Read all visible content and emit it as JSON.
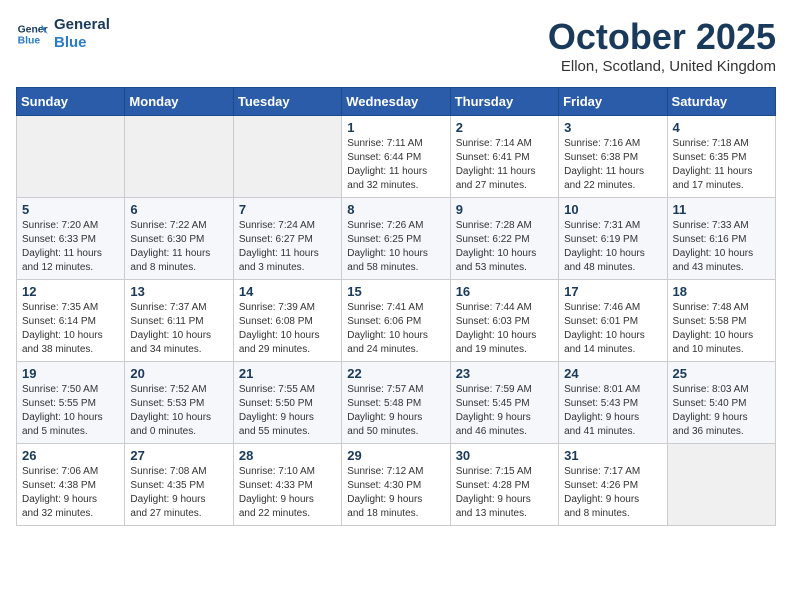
{
  "header": {
    "logo_line1": "General",
    "logo_line2": "Blue",
    "month_title": "October 2025",
    "location": "Ellon, Scotland, United Kingdom"
  },
  "weekdays": [
    "Sunday",
    "Monday",
    "Tuesday",
    "Wednesday",
    "Thursday",
    "Friday",
    "Saturday"
  ],
  "weeks": [
    [
      {
        "day": "",
        "info": ""
      },
      {
        "day": "",
        "info": ""
      },
      {
        "day": "",
        "info": ""
      },
      {
        "day": "1",
        "info": "Sunrise: 7:11 AM\nSunset: 6:44 PM\nDaylight: 11 hours\nand 32 minutes."
      },
      {
        "day": "2",
        "info": "Sunrise: 7:14 AM\nSunset: 6:41 PM\nDaylight: 11 hours\nand 27 minutes."
      },
      {
        "day": "3",
        "info": "Sunrise: 7:16 AM\nSunset: 6:38 PM\nDaylight: 11 hours\nand 22 minutes."
      },
      {
        "day": "4",
        "info": "Sunrise: 7:18 AM\nSunset: 6:35 PM\nDaylight: 11 hours\nand 17 minutes."
      }
    ],
    [
      {
        "day": "5",
        "info": "Sunrise: 7:20 AM\nSunset: 6:33 PM\nDaylight: 11 hours\nand 12 minutes."
      },
      {
        "day": "6",
        "info": "Sunrise: 7:22 AM\nSunset: 6:30 PM\nDaylight: 11 hours\nand 8 minutes."
      },
      {
        "day": "7",
        "info": "Sunrise: 7:24 AM\nSunset: 6:27 PM\nDaylight: 11 hours\nand 3 minutes."
      },
      {
        "day": "8",
        "info": "Sunrise: 7:26 AM\nSunset: 6:25 PM\nDaylight: 10 hours\nand 58 minutes."
      },
      {
        "day": "9",
        "info": "Sunrise: 7:28 AM\nSunset: 6:22 PM\nDaylight: 10 hours\nand 53 minutes."
      },
      {
        "day": "10",
        "info": "Sunrise: 7:31 AM\nSunset: 6:19 PM\nDaylight: 10 hours\nand 48 minutes."
      },
      {
        "day": "11",
        "info": "Sunrise: 7:33 AM\nSunset: 6:16 PM\nDaylight: 10 hours\nand 43 minutes."
      }
    ],
    [
      {
        "day": "12",
        "info": "Sunrise: 7:35 AM\nSunset: 6:14 PM\nDaylight: 10 hours\nand 38 minutes."
      },
      {
        "day": "13",
        "info": "Sunrise: 7:37 AM\nSunset: 6:11 PM\nDaylight: 10 hours\nand 34 minutes."
      },
      {
        "day": "14",
        "info": "Sunrise: 7:39 AM\nSunset: 6:08 PM\nDaylight: 10 hours\nand 29 minutes."
      },
      {
        "day": "15",
        "info": "Sunrise: 7:41 AM\nSunset: 6:06 PM\nDaylight: 10 hours\nand 24 minutes."
      },
      {
        "day": "16",
        "info": "Sunrise: 7:44 AM\nSunset: 6:03 PM\nDaylight: 10 hours\nand 19 minutes."
      },
      {
        "day": "17",
        "info": "Sunrise: 7:46 AM\nSunset: 6:01 PM\nDaylight: 10 hours\nand 14 minutes."
      },
      {
        "day": "18",
        "info": "Sunrise: 7:48 AM\nSunset: 5:58 PM\nDaylight: 10 hours\nand 10 minutes."
      }
    ],
    [
      {
        "day": "19",
        "info": "Sunrise: 7:50 AM\nSunset: 5:55 PM\nDaylight: 10 hours\nand 5 minutes."
      },
      {
        "day": "20",
        "info": "Sunrise: 7:52 AM\nSunset: 5:53 PM\nDaylight: 10 hours\nand 0 minutes."
      },
      {
        "day": "21",
        "info": "Sunrise: 7:55 AM\nSunset: 5:50 PM\nDaylight: 9 hours\nand 55 minutes."
      },
      {
        "day": "22",
        "info": "Sunrise: 7:57 AM\nSunset: 5:48 PM\nDaylight: 9 hours\nand 50 minutes."
      },
      {
        "day": "23",
        "info": "Sunrise: 7:59 AM\nSunset: 5:45 PM\nDaylight: 9 hours\nand 46 minutes."
      },
      {
        "day": "24",
        "info": "Sunrise: 8:01 AM\nSunset: 5:43 PM\nDaylight: 9 hours\nand 41 minutes."
      },
      {
        "day": "25",
        "info": "Sunrise: 8:03 AM\nSunset: 5:40 PM\nDaylight: 9 hours\nand 36 minutes."
      }
    ],
    [
      {
        "day": "26",
        "info": "Sunrise: 7:06 AM\nSunset: 4:38 PM\nDaylight: 9 hours\nand 32 minutes."
      },
      {
        "day": "27",
        "info": "Sunrise: 7:08 AM\nSunset: 4:35 PM\nDaylight: 9 hours\nand 27 minutes."
      },
      {
        "day": "28",
        "info": "Sunrise: 7:10 AM\nSunset: 4:33 PM\nDaylight: 9 hours\nand 22 minutes."
      },
      {
        "day": "29",
        "info": "Sunrise: 7:12 AM\nSunset: 4:30 PM\nDaylight: 9 hours\nand 18 minutes."
      },
      {
        "day": "30",
        "info": "Sunrise: 7:15 AM\nSunset: 4:28 PM\nDaylight: 9 hours\nand 13 minutes."
      },
      {
        "day": "31",
        "info": "Sunrise: 7:17 AM\nSunset: 4:26 PM\nDaylight: 9 hours\nand 8 minutes."
      },
      {
        "day": "",
        "info": ""
      }
    ]
  ]
}
